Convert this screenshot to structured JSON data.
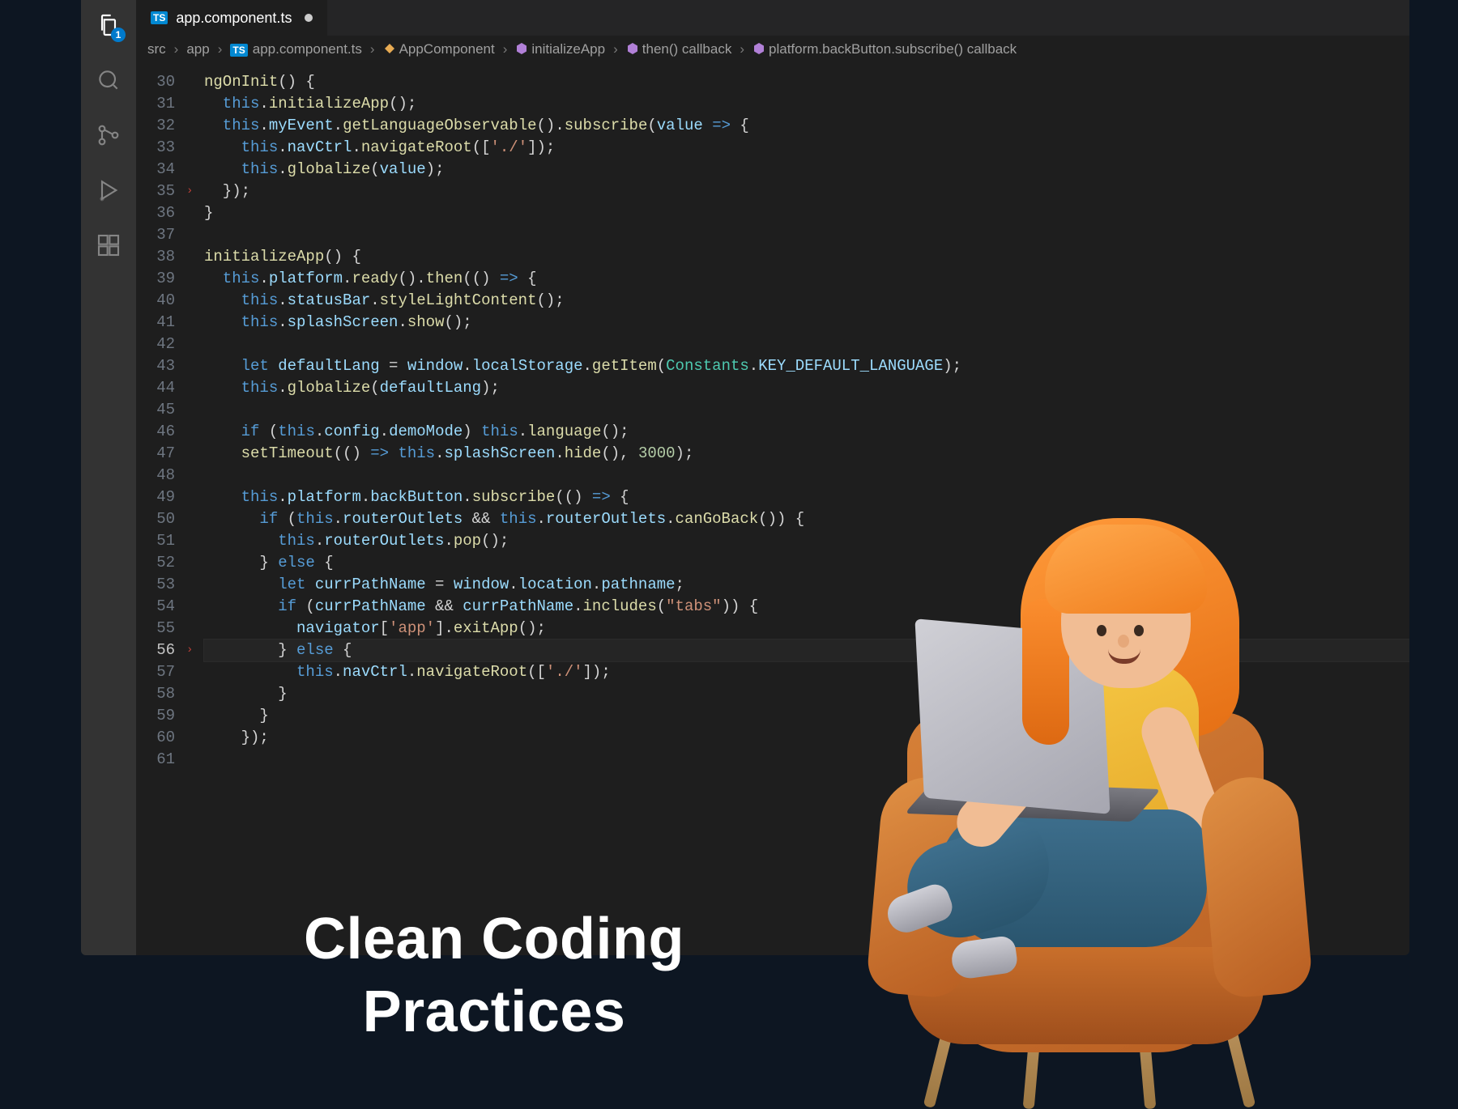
{
  "activityBar": {
    "explorerBadge": "1"
  },
  "tab": {
    "badge": "TS",
    "filename": "app.component.ts"
  },
  "breadcrumb": {
    "p0": "src",
    "p1": "app",
    "p2": "app.component.ts",
    "p3": "AppComponent",
    "p4": "initializeApp",
    "p5": "then() callback",
    "p6": "platform.backButton.subscribe() callback"
  },
  "lineStart": 30,
  "lineEnd": 61,
  "activeLine": 56,
  "arrows": {
    "35": "›",
    "56": "›"
  },
  "code": {
    "30": [
      [
        "fn",
        "ngOnInit"
      ],
      [
        "pun",
        "() {"
      ]
    ],
    "31": [
      [
        "kw",
        "  this"
      ],
      [
        "pun",
        "."
      ],
      [
        "fn",
        "initializeApp"
      ],
      [
        "pun",
        "();"
      ]
    ],
    "32": [
      [
        "kw",
        "  this"
      ],
      [
        "pun",
        "."
      ],
      [
        "prop",
        "myEvent"
      ],
      [
        "pun",
        "."
      ],
      [
        "fn",
        "getLanguageObservable"
      ],
      [
        "pun",
        "()."
      ],
      [
        "fn",
        "subscribe"
      ],
      [
        "pun",
        "("
      ],
      [
        "param",
        "value"
      ],
      [
        "pun",
        " "
      ],
      [
        "kw",
        "=>"
      ],
      [
        "pun",
        " {"
      ]
    ],
    "33": [
      [
        "kw",
        "    this"
      ],
      [
        "pun",
        "."
      ],
      [
        "prop",
        "navCtrl"
      ],
      [
        "pun",
        "."
      ],
      [
        "fn",
        "navigateRoot"
      ],
      [
        "pun",
        "(["
      ],
      [
        "str",
        "'./'"
      ],
      [
        "pun",
        "]);"
      ]
    ],
    "34": [
      [
        "kw",
        "    this"
      ],
      [
        "pun",
        "."
      ],
      [
        "fn",
        "globalize"
      ],
      [
        "pun",
        "("
      ],
      [
        "param",
        "value"
      ],
      [
        "pun",
        ");"
      ]
    ],
    "35": [
      [
        "pun",
        "  });"
      ]
    ],
    "36": [
      [
        "pun",
        "}"
      ]
    ],
    "37": [
      [
        "pun",
        ""
      ]
    ],
    "38": [
      [
        "fn",
        "initializeApp"
      ],
      [
        "pun",
        "() {"
      ]
    ],
    "39": [
      [
        "kw",
        "  this"
      ],
      [
        "pun",
        "."
      ],
      [
        "prop",
        "platform"
      ],
      [
        "pun",
        "."
      ],
      [
        "fn",
        "ready"
      ],
      [
        "pun",
        "()."
      ],
      [
        "fn",
        "then"
      ],
      [
        "pun",
        "(() "
      ],
      [
        "kw",
        "=>"
      ],
      [
        "pun",
        " {"
      ]
    ],
    "40": [
      [
        "kw",
        "    this"
      ],
      [
        "pun",
        "."
      ],
      [
        "prop",
        "statusBar"
      ],
      [
        "pun",
        "."
      ],
      [
        "fn",
        "styleLightContent"
      ],
      [
        "pun",
        "();"
      ]
    ],
    "41": [
      [
        "kw",
        "    this"
      ],
      [
        "pun",
        "."
      ],
      [
        "prop",
        "splashScreen"
      ],
      [
        "pun",
        "."
      ],
      [
        "fn",
        "show"
      ],
      [
        "pun",
        "();"
      ]
    ],
    "42": [
      [
        "pun",
        ""
      ]
    ],
    "43": [
      [
        "kw",
        "    let "
      ],
      [
        "var",
        "defaultLang"
      ],
      [
        "pun",
        " = "
      ],
      [
        "prop",
        "window"
      ],
      [
        "pun",
        "."
      ],
      [
        "prop",
        "localStorage"
      ],
      [
        "pun",
        "."
      ],
      [
        "fn",
        "getItem"
      ],
      [
        "pun",
        "("
      ],
      [
        "cls",
        "Constants"
      ],
      [
        "pun",
        "."
      ],
      [
        "const",
        "KEY_DEFAULT_LANGUAGE"
      ],
      [
        "pun",
        ");"
      ]
    ],
    "44": [
      [
        "kw",
        "    this"
      ],
      [
        "pun",
        "."
      ],
      [
        "fn",
        "globalize"
      ],
      [
        "pun",
        "("
      ],
      [
        "var",
        "defaultLang"
      ],
      [
        "pun",
        ");"
      ]
    ],
    "45": [
      [
        "pun",
        ""
      ]
    ],
    "46": [
      [
        "kw",
        "    if"
      ],
      [
        "pun",
        " ("
      ],
      [
        "kw",
        "this"
      ],
      [
        "pun",
        "."
      ],
      [
        "prop",
        "config"
      ],
      [
        "pun",
        "."
      ],
      [
        "prop",
        "demoMode"
      ],
      [
        "pun",
        ") "
      ],
      [
        "kw",
        "this"
      ],
      [
        "pun",
        "."
      ],
      [
        "fn",
        "language"
      ],
      [
        "pun",
        "();"
      ]
    ],
    "47": [
      [
        "fn",
        "    setTimeout"
      ],
      [
        "pun",
        "(() "
      ],
      [
        "kw",
        "=>"
      ],
      [
        "pun",
        " "
      ],
      [
        "kw",
        "this"
      ],
      [
        "pun",
        "."
      ],
      [
        "prop",
        "splashScreen"
      ],
      [
        "pun",
        "."
      ],
      [
        "fn",
        "hide"
      ],
      [
        "pun",
        "(), "
      ],
      [
        "num",
        "3000"
      ],
      [
        "pun",
        ");"
      ]
    ],
    "48": [
      [
        "pun",
        ""
      ]
    ],
    "49": [
      [
        "kw",
        "    this"
      ],
      [
        "pun",
        "."
      ],
      [
        "prop",
        "platform"
      ],
      [
        "pun",
        "."
      ],
      [
        "prop",
        "backButton"
      ],
      [
        "pun",
        "."
      ],
      [
        "fn",
        "subscribe"
      ],
      [
        "pun",
        "(() "
      ],
      [
        "kw",
        "=>"
      ],
      [
        "pun",
        " {"
      ]
    ],
    "50": [
      [
        "kw",
        "      if"
      ],
      [
        "pun",
        " ("
      ],
      [
        "kw",
        "this"
      ],
      [
        "pun",
        "."
      ],
      [
        "prop",
        "routerOutlets"
      ],
      [
        "pun",
        " && "
      ],
      [
        "kw",
        "this"
      ],
      [
        "pun",
        "."
      ],
      [
        "prop",
        "routerOutlets"
      ],
      [
        "pun",
        "."
      ],
      [
        "fn",
        "canGoBack"
      ],
      [
        "pun",
        "()) {"
      ]
    ],
    "51": [
      [
        "kw",
        "        this"
      ],
      [
        "pun",
        "."
      ],
      [
        "prop",
        "routerOutlets"
      ],
      [
        "pun",
        "."
      ],
      [
        "fn",
        "pop"
      ],
      [
        "pun",
        "();"
      ]
    ],
    "52": [
      [
        "pun",
        "      } "
      ],
      [
        "kw",
        "else"
      ],
      [
        "pun",
        " {"
      ]
    ],
    "53": [
      [
        "kw",
        "        let "
      ],
      [
        "var",
        "currPathName"
      ],
      [
        "pun",
        " = "
      ],
      [
        "prop",
        "window"
      ],
      [
        "pun",
        "."
      ],
      [
        "prop",
        "location"
      ],
      [
        "pun",
        "."
      ],
      [
        "prop",
        "pathname"
      ],
      [
        "pun",
        ";"
      ]
    ],
    "54": [
      [
        "kw",
        "        if"
      ],
      [
        "pun",
        " ("
      ],
      [
        "var",
        "currPathName"
      ],
      [
        "pun",
        " && "
      ],
      [
        "var",
        "currPathName"
      ],
      [
        "pun",
        "."
      ],
      [
        "fn",
        "includes"
      ],
      [
        "pun",
        "("
      ],
      [
        "str",
        "\"tabs\""
      ],
      [
        "pun",
        ")) {"
      ]
    ],
    "55": [
      [
        "prop",
        "          navigator"
      ],
      [
        "pun",
        "["
      ],
      [
        "str",
        "'app'"
      ],
      [
        "pun",
        "]."
      ],
      [
        "fn",
        "exitApp"
      ],
      [
        "pun",
        "();"
      ]
    ],
    "56": [
      [
        "pun",
        "        } "
      ],
      [
        "kw",
        "else"
      ],
      [
        "pun",
        " {"
      ]
    ],
    "57": [
      [
        "kw",
        "          this"
      ],
      [
        "pun",
        "."
      ],
      [
        "prop",
        "navCtrl"
      ],
      [
        "pun",
        "."
      ],
      [
        "fn",
        "navigateRoot"
      ],
      [
        "pun",
        "(["
      ],
      [
        "str",
        "'./'"
      ],
      [
        "pun",
        "]);"
      ]
    ],
    "58": [
      [
        "pun",
        "        }"
      ]
    ],
    "59": [
      [
        "pun",
        "      }"
      ]
    ],
    "60": [
      [
        "pun",
        "    });"
      ]
    ],
    "61": [
      [
        "pun",
        ""
      ]
    ]
  },
  "overlay": {
    "line1": "Clean Coding",
    "line2": "Practices"
  }
}
